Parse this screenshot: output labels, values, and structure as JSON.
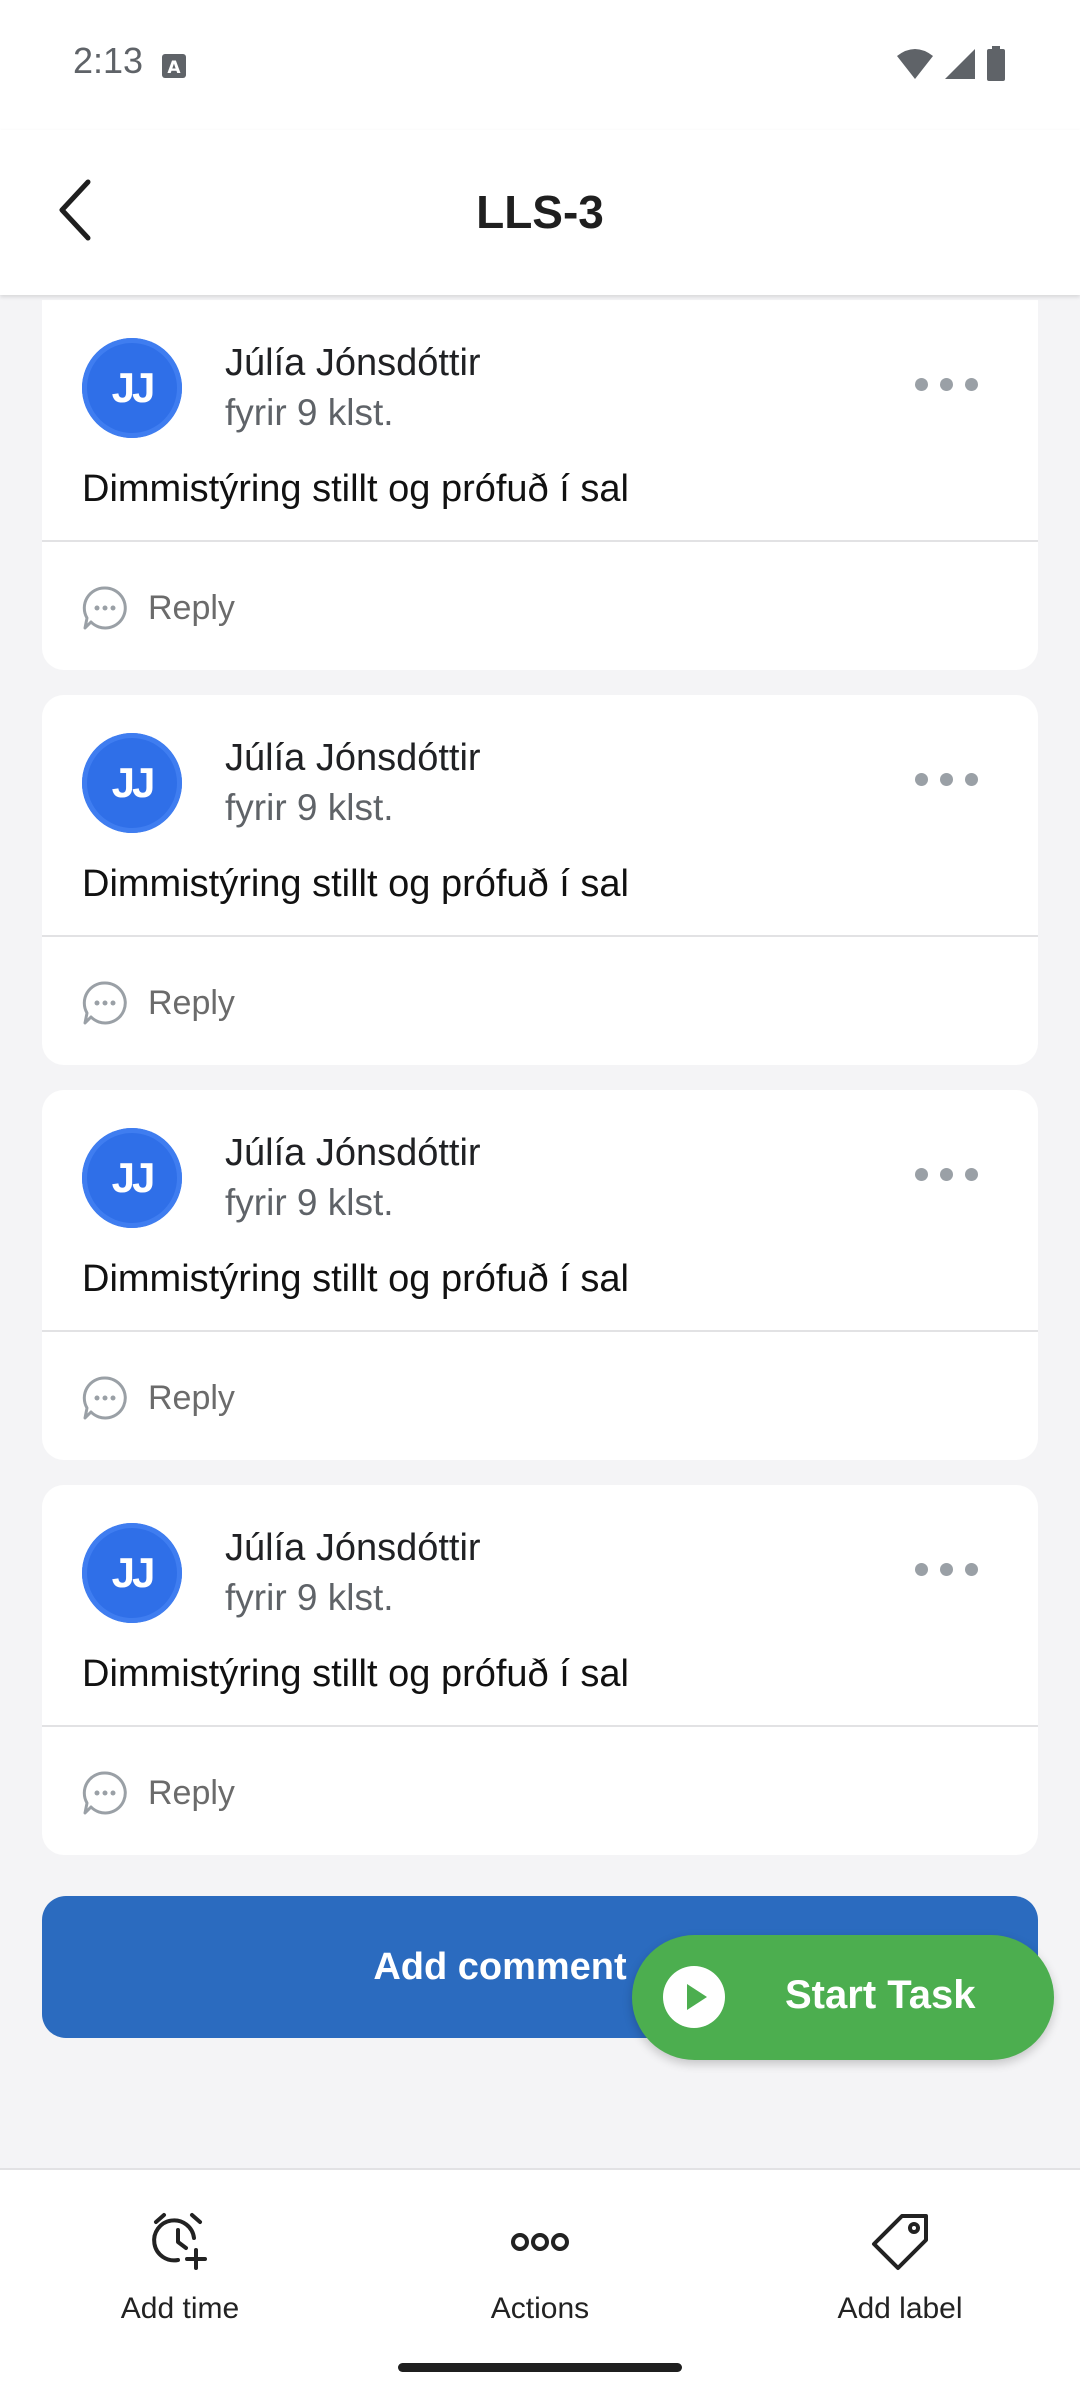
{
  "status_bar": {
    "time": "2:13"
  },
  "header": {
    "title": "LLS-3"
  },
  "comments": [
    {
      "initials": "JJ",
      "author": "Júlía Jónsdóttir",
      "time": "fyrir 9 klst.",
      "text": "Dimmistýring stillt og prófuð í sal",
      "reply_label": "Reply"
    },
    {
      "initials": "JJ",
      "author": "Júlía Jónsdóttir",
      "time": "fyrir 9 klst.",
      "text": "Dimmistýring stillt og prófuð í sal",
      "reply_label": "Reply"
    },
    {
      "initials": "JJ",
      "author": "Júlía Jónsdóttir",
      "time": "fyrir 9 klst.",
      "text": "Dimmistýring stillt og prófuð í sal",
      "reply_label": "Reply"
    },
    {
      "initials": "JJ",
      "author": "Júlía Jónsdóttir",
      "time": "fyrir 9 klst.",
      "text": "Dimmistýring stillt og prófuð í sal",
      "reply_label": "Reply"
    }
  ],
  "add_comment_label": "Add comment",
  "fab": {
    "label": "Start Task",
    "color": "#4cae4f"
  },
  "bottom_nav": [
    {
      "label": "Add time",
      "icon": "add-time-icon"
    },
    {
      "label": "Actions",
      "icon": "more-horizontal-icon"
    },
    {
      "label": "Add label",
      "icon": "tag-icon"
    }
  ],
  "colors": {
    "primary": "#2b6bbf",
    "avatar": "#2f6fe8",
    "success": "#4cae4f"
  }
}
